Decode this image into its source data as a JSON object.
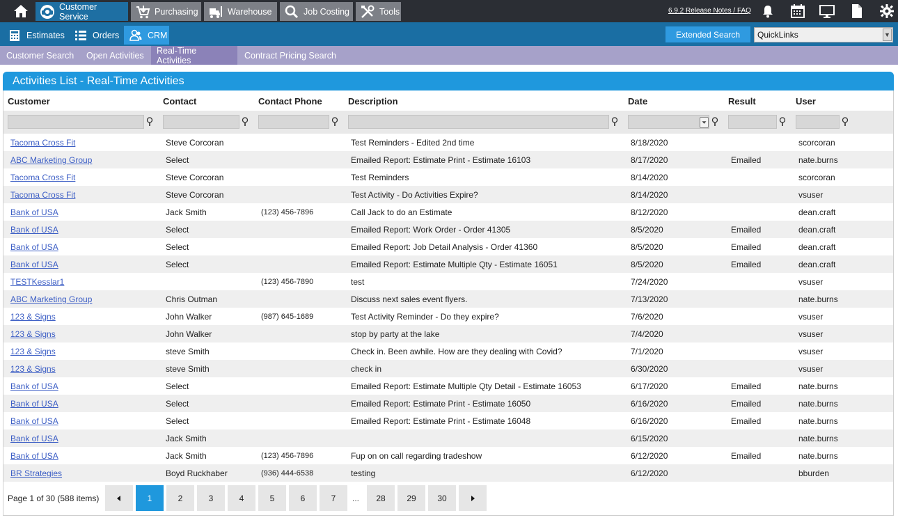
{
  "topnav": {
    "home_icon": "home-icon",
    "tabs": [
      {
        "label": "Customer Service",
        "icon": "headset-icon"
      },
      {
        "label": "Purchasing",
        "icon": "cart-icon"
      },
      {
        "label": "Warehouse",
        "icon": "forklift-icon"
      },
      {
        "label": "Job Costing",
        "icon": "magnifier-icon"
      },
      {
        "label": "Tools",
        "icon": "tools-icon"
      }
    ],
    "release_notes": "6.9.2 Release Notes / FAQ",
    "right_icons": [
      "bell-icon",
      "calendar-icon",
      "monitor-icon",
      "document-icon",
      "gear-icon"
    ]
  },
  "subnav": {
    "tabs": [
      {
        "label": "Estimates",
        "icon": "calculator-icon"
      },
      {
        "label": "Orders",
        "icon": "list-icon"
      },
      {
        "label": "CRM",
        "icon": "users-icon"
      }
    ],
    "extended_search": "Extended Search",
    "quicklinks_value": "QuickLinks"
  },
  "crmnav": {
    "tabs": [
      "Customer Search",
      "Open Activities",
      "Real-Time Activities",
      "Contract Pricing Search"
    ]
  },
  "panel": {
    "title": "Activities List - Real-Time Activities"
  },
  "columns": [
    "Customer",
    "Contact",
    "Contact Phone",
    "Description",
    "Date",
    "Result",
    "User"
  ],
  "rows": [
    {
      "customer": "Tacoma Cross Fit",
      "contact": "Steve Corcoran",
      "phone": "",
      "description": "Test Reminders - Edited 2nd time",
      "date": "8/18/2020",
      "result": "",
      "user": "scorcoran"
    },
    {
      "customer": "ABC Marketing Group",
      "contact": "Select",
      "phone": "",
      "description": "Emailed Report: Estimate Print - Estimate 16103",
      "date": "8/17/2020",
      "result": "Emailed",
      "user": "nate.burns"
    },
    {
      "customer": "Tacoma Cross Fit",
      "contact": "Steve Corcoran",
      "phone": "",
      "description": "Test Reminders",
      "date": "8/14/2020",
      "result": "",
      "user": "scorcoran"
    },
    {
      "customer": "Tacoma Cross Fit",
      "contact": "Steve Corcoran",
      "phone": "",
      "description": "Test Activity - Do Activities Expire?",
      "date": "8/14/2020",
      "result": "",
      "user": "vsuser"
    },
    {
      "customer": "Bank of USA",
      "contact": "Jack Smith",
      "phone": "(123) 456-7896",
      "description": "Call Jack to do an Estimate",
      "date": "8/12/2020",
      "result": "",
      "user": "dean.craft"
    },
    {
      "customer": "Bank of USA",
      "contact": "Select",
      "phone": "",
      "description": "Emailed Report: Work Order - Order 41305",
      "date": "8/5/2020",
      "result": "Emailed",
      "user": "dean.craft"
    },
    {
      "customer": "Bank of USA",
      "contact": "Select",
      "phone": "",
      "description": "Emailed Report: Job Detail Analysis - Order 41360",
      "date": "8/5/2020",
      "result": "Emailed",
      "user": "dean.craft"
    },
    {
      "customer": "Bank of USA",
      "contact": "Select",
      "phone": "",
      "description": "Emailed Report: Estimate Multiple Qty - Estimate 16051",
      "date": "8/5/2020",
      "result": "Emailed",
      "user": "dean.craft"
    },
    {
      "customer": "TESTKesslar1",
      "contact": "",
      "phone": "(123) 456-7890",
      "description": "test",
      "date": "7/24/2020",
      "result": "",
      "user": "vsuser"
    },
    {
      "customer": "ABC Marketing Group",
      "contact": "Chris Outman",
      "phone": "",
      "description": "Discuss next sales event flyers.",
      "date": "7/13/2020",
      "result": "",
      "user": "nate.burns"
    },
    {
      "customer": "123 & Signs",
      "contact": "John Walker",
      "phone": "(987) 645-1689",
      "description": "Test Activity Reminder - Do they expire?",
      "date": "7/6/2020",
      "result": "",
      "user": "vsuser"
    },
    {
      "customer": "123 & Signs",
      "contact": "John Walker",
      "phone": "",
      "description": "stop by party at the lake",
      "date": "7/4/2020",
      "result": "",
      "user": "vsuser"
    },
    {
      "customer": "123 & Signs",
      "contact": "steve Smith",
      "phone": "",
      "description": "Check in. Been awhile. How are they dealing with Covid?",
      "date": "7/1/2020",
      "result": "",
      "user": "vsuser"
    },
    {
      "customer": "123 & Signs",
      "contact": "steve Smith",
      "phone": "",
      "description": "check in",
      "date": "6/30/2020",
      "result": "",
      "user": "vsuser"
    },
    {
      "customer": "Bank of USA",
      "contact": "Select",
      "phone": "",
      "description": "Emailed Report: Estimate Multiple Qty Detail - Estimate 16053",
      "date": "6/17/2020",
      "result": "Emailed",
      "user": "nate.burns"
    },
    {
      "customer": "Bank of USA",
      "contact": "Select",
      "phone": "",
      "description": "Emailed Report: Estimate Print - Estimate 16050",
      "date": "6/16/2020",
      "result": "Emailed",
      "user": "nate.burns"
    },
    {
      "customer": "Bank of USA",
      "contact": "Select",
      "phone": "",
      "description": "Emailed Report: Estimate Print - Estimate 16048",
      "date": "6/16/2020",
      "result": "Emailed",
      "user": "nate.burns"
    },
    {
      "customer": "Bank of USA",
      "contact": "Jack Smith",
      "phone": "",
      "description": "",
      "date": "6/15/2020",
      "result": "",
      "user": "nate.burns"
    },
    {
      "customer": "Bank of USA",
      "contact": "Jack Smith",
      "phone": "(123) 456-7896",
      "description": "Fup on on call regarding tradeshow",
      "date": "6/12/2020",
      "result": "Emailed",
      "user": "nate.burns"
    },
    {
      "customer": "BR Strategies",
      "contact": "Boyd Ruckhaber",
      "phone": "(936) 444-6538",
      "description": "testing",
      "date": "6/12/2020",
      "result": "",
      "user": "bburden"
    }
  ],
  "pager": {
    "summary": "Page 1 of 30 (588 items)",
    "prev_icon": "triangle-left-icon",
    "next_icon": "triangle-right-icon",
    "pages": [
      "1",
      "2",
      "3",
      "4",
      "5",
      "6",
      "7",
      "28",
      "29",
      "30"
    ],
    "ellipsis": "...",
    "current_page": "1"
  },
  "colors": {
    "topbar": "#2b2e34",
    "top_tab": "#7d8087",
    "top_tab_active": "#1e6fa3",
    "secbar": "#1a6ea3",
    "accent": "#2f9ae0",
    "subbar": "#a6a1c9",
    "subbar_active": "#8b82b8",
    "panel_header": "#1f98dd",
    "link": "#3c5ec5"
  }
}
